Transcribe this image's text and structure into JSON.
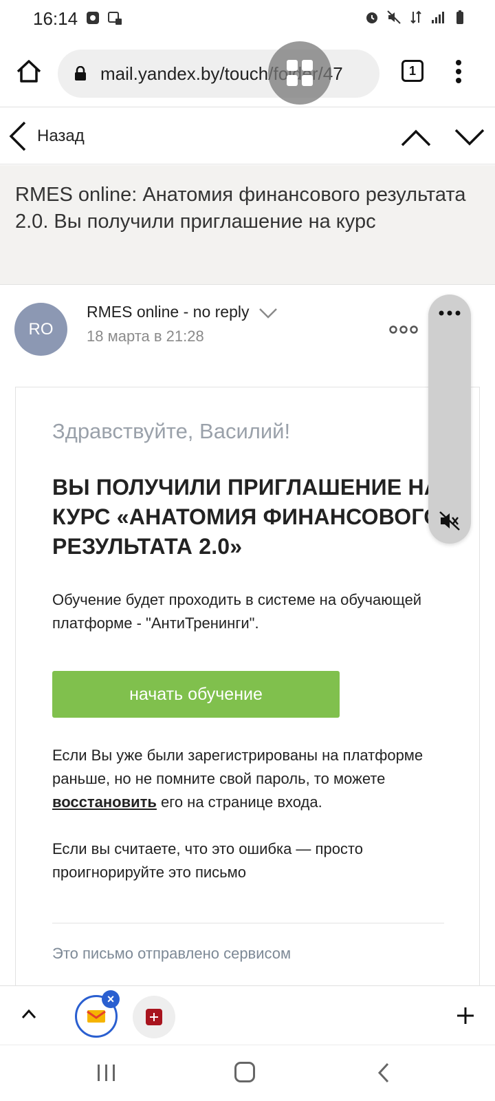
{
  "status_bar": {
    "time": "16:14"
  },
  "browser": {
    "url": "mail.yandex.by/touch/folder/47",
    "tab_count": "1"
  },
  "mail_nav": {
    "back_label": "Назад"
  },
  "message": {
    "subject": "RMES online: Анатомия финансового результата 2.0. Вы получили приглашение на курс",
    "sender_initials": "RO",
    "sender_name": "RMES online - no reply",
    "date": "18 марта в 21:28"
  },
  "email_body": {
    "greeting": "Здравствуйте, Василий!",
    "headline": "ВЫ ПОЛУЧИЛИ ПРИГЛАШЕНИЕ НА КУРС «АНАТОМИЯ ФИНАНСОВОГО РЕЗУЛЬТАТА 2.0»",
    "intro": "Обучение будет проходить в системе на обучающей платформе - \"АнтиТренинги\".",
    "cta_label": "начать обучение",
    "restore_before": "Если Вы уже были зарегистрированы на платформе раньше, но не помните свой пароль, то можете ",
    "restore_link": "восстановить",
    "restore_after": " его на странице входа.",
    "error_note": "Если вы считаете, что это ошибка — просто проигнорируйте это письмо",
    "footer": "Это письмо отправлено сервисом"
  },
  "colors": {
    "cta": "#80c04d",
    "avatar": "#8c98b3",
    "accent_blue": "#2a5fd0"
  }
}
